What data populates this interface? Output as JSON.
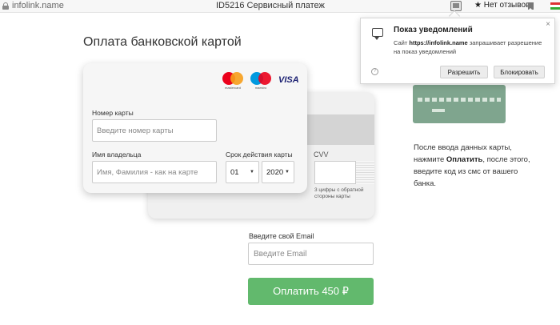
{
  "browser": {
    "domain": "infolink.name",
    "page_title": "ID5216 Сервисный платеж",
    "reviews": "★ Нет отзывов"
  },
  "heading": "Оплата банковской картой",
  "card": {
    "number_label": "Номер карты",
    "number_placeholder": "Введите номер карты",
    "holder_label": "Имя владельца",
    "holder_placeholder": "Имя, Фамилия - как на карте",
    "expiry_label": "Срок действия карты",
    "month": "01",
    "year": "2020",
    "cvv_label": "CVV",
    "cvv_hint": "3 цифры с обратной стороны карты",
    "logos": {
      "mastercard": "mastercard",
      "maestro": "maestro",
      "visa": "VISA"
    }
  },
  "instruction": {
    "before": "После ввода данных карты, нажмите ",
    "bold": "Оплатить",
    "after": ", после этого, введите код из смс от вашего банка."
  },
  "email": {
    "label": "Введите свой Email",
    "placeholder": "Введите Email"
  },
  "pay_button": "Оплатить 450 ₽",
  "notification": {
    "title": "Показ уведомлений",
    "text_before": "Сайт ",
    "site": "https://infolink.name",
    "text_after": " запрашивает разрешение на показ уведомлений",
    "allow": "Разрешить",
    "block": "Блокировать",
    "close": "×"
  },
  "colors": {
    "pay_button": "#62b96d",
    "visa": "#1a1f71"
  }
}
